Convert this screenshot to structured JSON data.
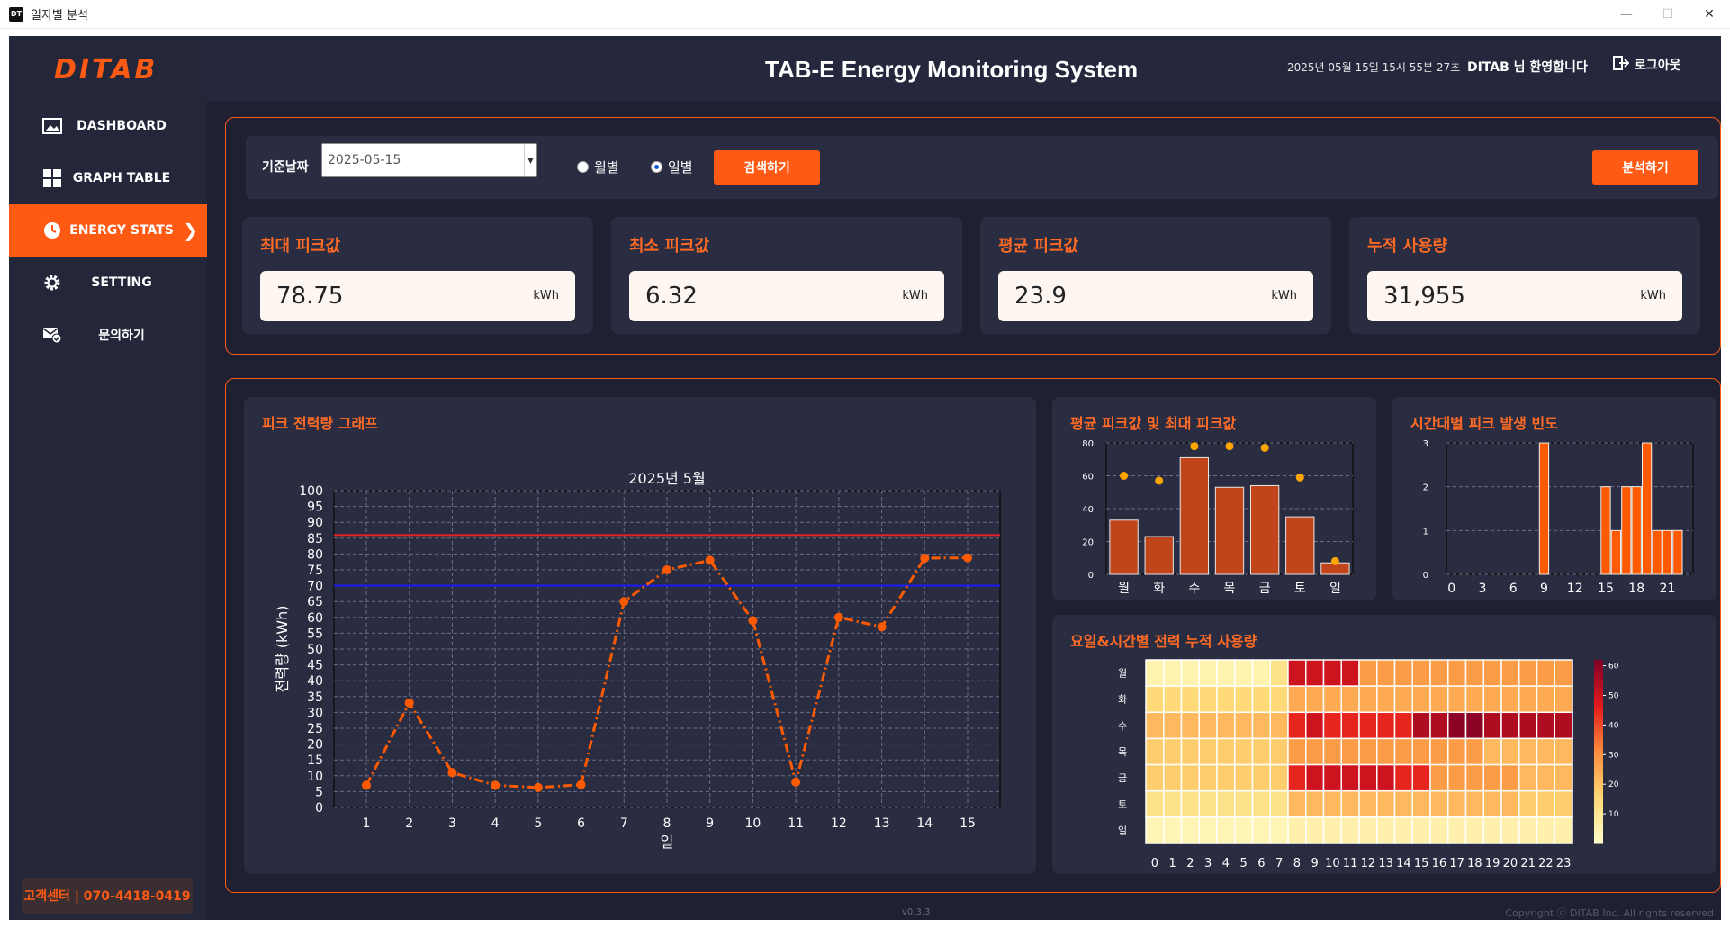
{
  "window": {
    "title": "일자별 분석",
    "app_icon_text": "DT",
    "minimize": "—",
    "maximize": "☐",
    "close": "✕"
  },
  "sidebar": {
    "logo": "DITAB",
    "items": [
      {
        "label": "DASHBOARD",
        "icon": "image-icon"
      },
      {
        "label": "GRAPH TABLE",
        "icon": "grid-icon"
      },
      {
        "label": "ENERGY STATS",
        "icon": "clock-icon",
        "active": true
      },
      {
        "label": "SETTING",
        "icon": "gear-icon"
      },
      {
        "label": "문의하기",
        "icon": "mail-check-icon"
      }
    ],
    "support": "고객센터 | 070-4418-0419"
  },
  "header": {
    "title": "TAB-E Energy Monitoring System",
    "datetime": "2025년 05월 15일 15시 55분 27초",
    "welcome": "DITAB 님 환영합니다",
    "logout": "로그아웃"
  },
  "search": {
    "date_label": "기준날짜",
    "date_value": "2025-05-15",
    "radio_monthly": "월별",
    "radio_daily": "일별",
    "selected": "일별",
    "search_button": "검색하기",
    "analyze_button": "분석하기"
  },
  "stats": [
    {
      "title": "최대 피크값",
      "value": "78.75",
      "unit": "kWh"
    },
    {
      "title": "최소 피크값",
      "value": "6.32",
      "unit": "kWh"
    },
    {
      "title": "평균 피크값",
      "value": "23.9",
      "unit": "kWh"
    },
    {
      "title": "누적 사용량",
      "value": "31,955",
      "unit": "kWh"
    }
  ],
  "cards": {
    "peak_graph": "피크 전력량 그래프",
    "avg_max": "평균 피크값 및 최대 피크값",
    "hourly_freq": "시간대별 피크 발생 빈도",
    "heatmap": "요일&시간별 전력 누적 사용량"
  },
  "footer": {
    "version": "v0.3.3",
    "copyright": "Copyright ⓒ DITAB Inc. All rights reserved"
  },
  "colors": {
    "accent": "#ff5a14",
    "bg": "#1f2133",
    "card": "#2a2d42",
    "red_line": "#e0202a",
    "blue_line": "#1a1aff",
    "bar": "#c0451a",
    "dot": "#ffa500"
  },
  "chart_data": [
    {
      "type": "line",
      "title": "2025년 5월",
      "xlabel": "일",
      "ylabel": "전력량 (kWh)",
      "x": [
        1,
        2,
        3,
        4,
        5,
        6,
        7,
        8,
        9,
        10,
        11,
        12,
        13,
        14,
        15
      ],
      "series": [
        {
          "values": [
            7,
            33,
            11,
            7,
            6.3,
            7.2,
            65,
            75,
            78,
            59,
            8,
            60,
            57,
            78.7,
            78.8
          ]
        }
      ],
      "hlines": [
        {
          "y": 86,
          "color": "#e0202a"
        },
        {
          "y": 70,
          "color": "#1a1aff"
        }
      ],
      "ylim": [
        0,
        100
      ],
      "yticks": [
        0,
        5,
        10,
        15,
        20,
        25,
        30,
        35,
        40,
        45,
        50,
        55,
        60,
        65,
        70,
        75,
        80,
        85,
        90,
        95,
        100
      ],
      "grid": true
    },
    {
      "type": "bar",
      "categories": [
        "월",
        "화",
        "수",
        "목",
        "금",
        "토",
        "일"
      ],
      "series": [
        {
          "values": [
            33,
            23,
            71,
            53,
            54,
            35,
            7
          ]
        },
        {
          "values": [
            60,
            57,
            78,
            78,
            77,
            59,
            8
          ]
        }
      ],
      "ylim": [
        0,
        80
      ],
      "yticks": [
        0,
        20,
        40,
        60,
        80
      ],
      "grid": true
    },
    {
      "type": "bar",
      "x": [
        0,
        1,
        2,
        3,
        4,
        5,
        6,
        7,
        8,
        9,
        10,
        11,
        12,
        13,
        14,
        15,
        16,
        17,
        18,
        19,
        20,
        21,
        22,
        23
      ],
      "values": [
        0,
        0,
        0,
        0,
        0,
        0,
        0,
        0,
        0,
        3,
        0,
        0,
        0,
        0,
        0,
        2,
        1,
        2,
        2,
        3,
        1,
        1,
        1,
        0
      ],
      "xticks": [
        0,
        3,
        6,
        9,
        12,
        15,
        18,
        21
      ],
      "ylim": [
        0,
        3
      ],
      "yticks": [
        0,
        1,
        2,
        3
      ],
      "grid": true
    },
    {
      "type": "heatmap",
      "rows": [
        "월",
        "화",
        "수",
        "목",
        "금",
        "토",
        "일"
      ],
      "cols": [
        0,
        1,
        2,
        3,
        4,
        5,
        6,
        7,
        8,
        9,
        10,
        11,
        12,
        13,
        14,
        15,
        16,
        17,
        18,
        19,
        20,
        21,
        22,
        23
      ],
      "colorbar_ticks": [
        10,
        20,
        30,
        40,
        50,
        60
      ],
      "vmin": 0,
      "vmax": 62,
      "values": [
        [
          5,
          5,
          5,
          5,
          5,
          5,
          5,
          12,
          50,
          50,
          50,
          50,
          28,
          28,
          28,
          28,
          28,
          28,
          28,
          28,
          28,
          28,
          28,
          28
        ],
        [
          15,
          15,
          15,
          15,
          15,
          15,
          15,
          15,
          25,
          25,
          25,
          25,
          25,
          25,
          25,
          25,
          25,
          25,
          25,
          25,
          25,
          25,
          25,
          25
        ],
        [
          22,
          22,
          22,
          22,
          22,
          22,
          22,
          22,
          45,
          50,
          45,
          45,
          45,
          45,
          45,
          55,
          55,
          60,
          60,
          55,
          55,
          55,
          55,
          55
        ],
        [
          18,
          18,
          18,
          18,
          18,
          18,
          18,
          18,
          28,
          28,
          28,
          28,
          28,
          28,
          28,
          28,
          28,
          28,
          28,
          22,
          22,
          22,
          22,
          22
        ],
        [
          18,
          18,
          18,
          18,
          18,
          18,
          18,
          18,
          45,
          50,
          50,
          50,
          50,
          50,
          45,
          45,
          28,
          28,
          28,
          28,
          28,
          22,
          22,
          22
        ],
        [
          12,
          12,
          12,
          12,
          12,
          12,
          12,
          12,
          22,
          22,
          22,
          22,
          22,
          22,
          22,
          22,
          22,
          22,
          22,
          22,
          22,
          18,
          18,
          18
        ],
        [
          4,
          4,
          4,
          4,
          4,
          4,
          4,
          4,
          6,
          6,
          6,
          6,
          6,
          6,
          6,
          6,
          6,
          6,
          6,
          6,
          6,
          6,
          6,
          6
        ]
      ]
    }
  ]
}
